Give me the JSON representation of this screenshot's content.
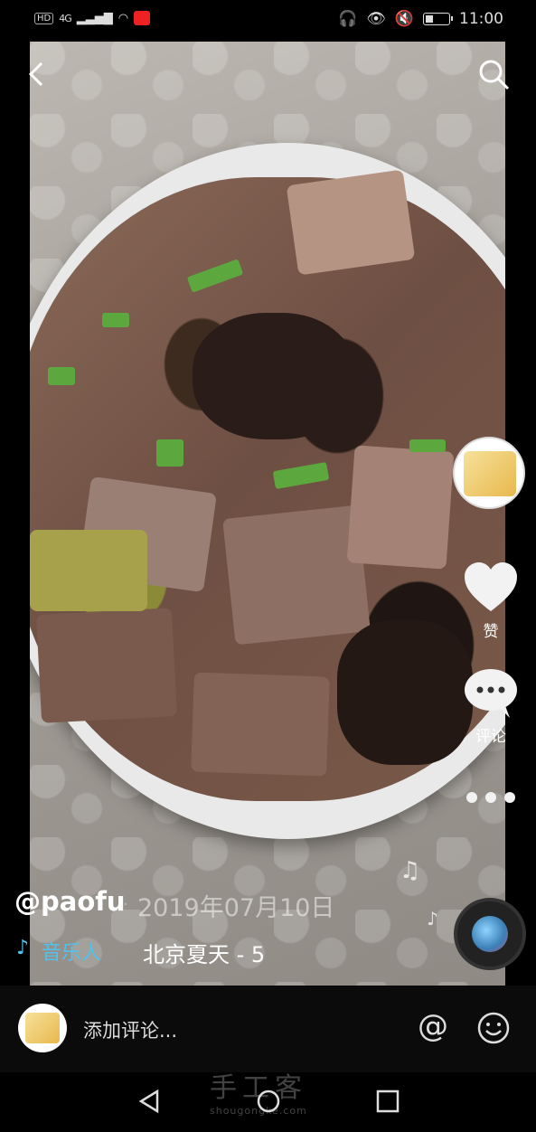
{
  "status_bar": {
    "left_badges": [
      "HD",
      "4G"
    ],
    "time": "11:00"
  },
  "post": {
    "username": "@paofu",
    "separator": "·",
    "date": "2019年07月10日",
    "music_label": "音乐人",
    "song_title": "北京夏天 - 5"
  },
  "rail": {
    "like_label": "赞",
    "comment_label": "评论"
  },
  "comment_bar": {
    "placeholder": "添加评论...",
    "at_symbol": "@"
  },
  "watermark": {
    "text": "手工客",
    "url": "shougongke.com"
  },
  "icons": {
    "back": "chevron-left-icon",
    "search": "search-icon",
    "like": "heart-icon",
    "comment": "speech-bubble-icon",
    "more": "more-horizontal-icon",
    "music": "music-note-icon",
    "emoji": "smiley-icon"
  },
  "colors": {
    "accent_music": "#4fc3ee",
    "background": "#000000"
  }
}
